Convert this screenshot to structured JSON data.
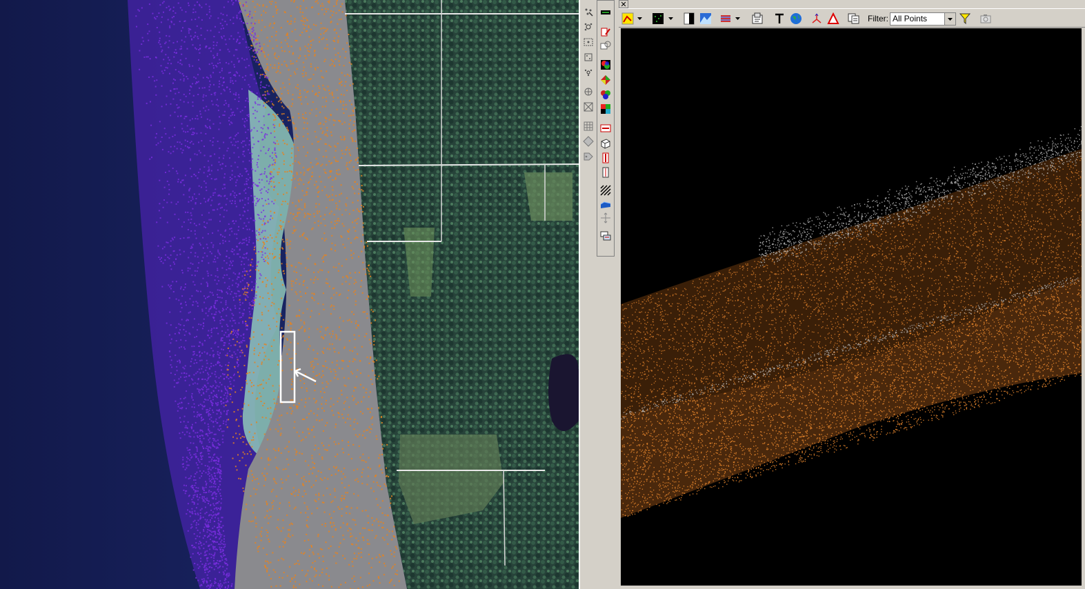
{
  "app": {
    "close_glyph": "✕"
  },
  "map_view": {
    "colors": {
      "water": "#141e55",
      "shallow": "#8fc7b8",
      "beach_gray": "#8a8a8e",
      "ground_points": "#e6821e",
      "water_points": "#7a2ee0",
      "forest": "#2c4a3e"
    },
    "selection_box_label": ""
  },
  "left_toolbar": {
    "icons": [
      "point-select-icon",
      "zoom-point-icon",
      "area-select-icon",
      "box-zoom-icon",
      "move-point-icon",
      "measure-icon",
      "zoom-extent-icon",
      "grid-icon",
      "diamond-icon",
      "tag-icon"
    ]
  },
  "right_toolbar": {
    "icons": [
      "legend-icon",
      "draw-pencil-icon",
      "copy-view-icon",
      "rgb-color-icon",
      "elevation-color-icon",
      "class-color-icon",
      "intensity-color-icon",
      "section-icon",
      "cube-icon",
      "red-bar-icon",
      "outline-bar-icon",
      "hatch-icon",
      "surface-icon",
      "pan-cross-icon",
      "layers-icon"
    ]
  },
  "profile_window": {
    "toolbar": {
      "icons": [
        "display-mode-icon",
        "point-display-icon",
        "contrast-icon",
        "view-mountain-icon",
        "classify-lines-icon",
        "properties-icon",
        "text-icon",
        "globe-icon",
        "axes-icon",
        "triangle-icon",
        "copy-icon",
        "filter-icon",
        "camera-icon"
      ],
      "filter_label": "Filter:",
      "filter_value": "All Points"
    },
    "colors": {
      "ground": "#e8872e",
      "vegetation": "#c0c0c0",
      "background": "#000000"
    }
  }
}
